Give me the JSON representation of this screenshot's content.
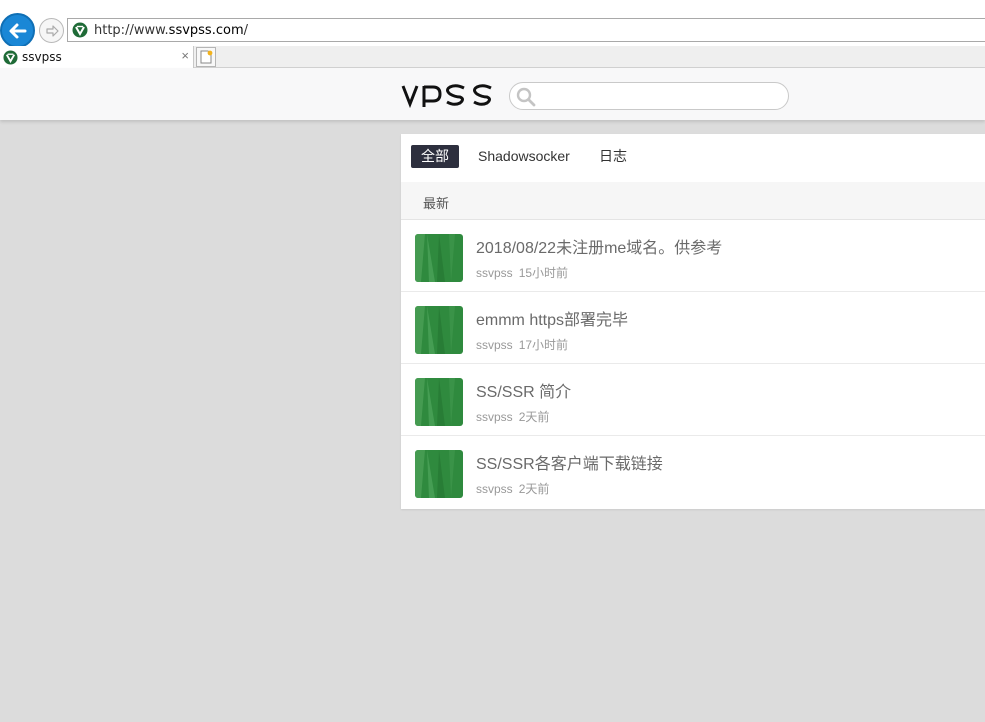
{
  "browser": {
    "url_prefix": "http://www.",
    "url_domain": "ssvpss.com",
    "url_suffix": "/",
    "tab_title": "ssvpss",
    "tab_close": "×"
  },
  "header": {
    "logo_text": "VPSS",
    "search": {
      "placeholder": "",
      "value": ""
    }
  },
  "nav": {
    "tabs": [
      {
        "label": "全部",
        "active": true
      },
      {
        "label": "Shadowsocker",
        "active": false
      },
      {
        "label": "日志",
        "active": false
      }
    ]
  },
  "subbar": {
    "label": "最新"
  },
  "posts": [
    {
      "title": "2018/08/22未注册me域名。供参考",
      "author": "ssvpss",
      "time": "15小时前"
    },
    {
      "title": "emmm https部署完毕",
      "author": "ssvpss",
      "time": "17小时前"
    },
    {
      "title": "SS/SSR 简介",
      "author": "ssvpss",
      "time": "2天前"
    },
    {
      "title": "SS/SSR各客户端下载链接",
      "author": "ssvpss",
      "time": "2天前"
    }
  ],
  "colors": {
    "nav_active_bg": "#2d2f3e",
    "thumb_green": "#2f8a3e",
    "back_button": "#1a87d6",
    "page_bg": "#dcdcdc"
  }
}
